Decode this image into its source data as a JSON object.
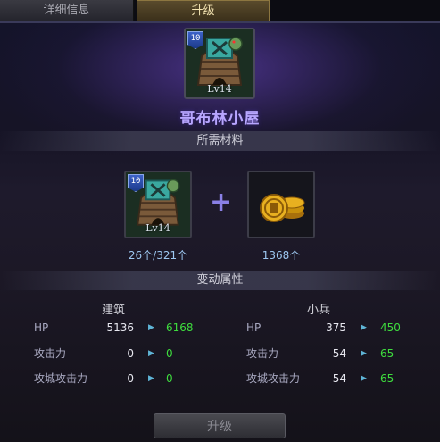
{
  "tabs": [
    {
      "label": "详细信息",
      "active": false
    },
    {
      "label": "升级",
      "active": true
    }
  ],
  "building": {
    "name": "哥布林小屋",
    "level_badge": "10",
    "level_text": "Lv14"
  },
  "materials": {
    "section_title": "所需材料",
    "items": [
      {
        "level_badge": "10",
        "level_text": "Lv14",
        "count_text": "26个/321个"
      },
      {
        "icon": "gold-coins-icon",
        "count_text": "1368个"
      }
    ]
  },
  "stats": {
    "section_title": "变动属性",
    "building": {
      "title": "建筑",
      "rows": [
        {
          "label": "HP",
          "current": "5136",
          "next": "6168"
        },
        {
          "label": "攻击力",
          "current": "0",
          "next": "0"
        },
        {
          "label": "攻城攻击力",
          "current": "0",
          "next": "0"
        }
      ]
    },
    "soldier": {
      "title": "小兵",
      "rows": [
        {
          "label": "HP",
          "current": "375",
          "next": "450"
        },
        {
          "label": "攻击力",
          "current": "54",
          "next": "65"
        },
        {
          "label": "攻城攻击力",
          "current": "54",
          "next": "65"
        }
      ]
    }
  },
  "upgrade_button": {
    "label": "升级",
    "enabled": false
  },
  "colors": {
    "name": "#b8a6ff",
    "increase": "#3edc3e",
    "count": "#9ec8f2"
  }
}
